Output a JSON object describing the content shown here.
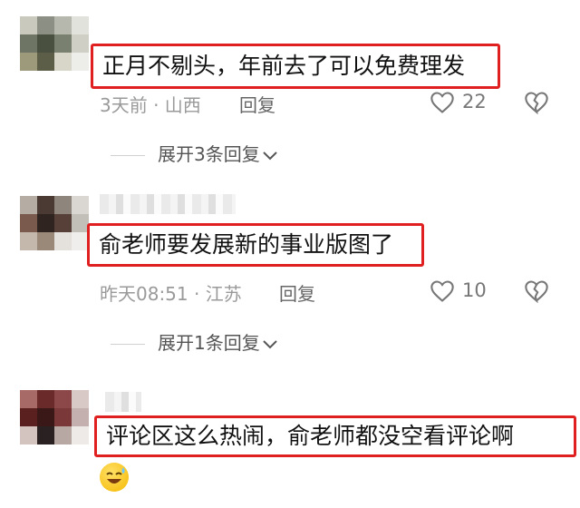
{
  "comments": [
    {
      "text": "正月不剔头，年前去了可以免费理发",
      "time_location": "3天前 · 山西",
      "reply_label": "回复",
      "likes": "22",
      "expand_label": "展开3条回复",
      "icons": [
        "heart-icon",
        "broken-heart-icon",
        "chevron-down-icon"
      ]
    },
    {
      "text": "俞老师要发展新的事业版图了",
      "time_location": "昨天08:51 · 江苏",
      "reply_label": "回复",
      "likes": "10",
      "expand_label": "展开1条回复",
      "icons": [
        "heart-icon",
        "broken-heart-icon",
        "chevron-down-icon"
      ]
    },
    {
      "text": "评论区这么热闹，俞老师都没空看评论啊",
      "emoji": "sweat-smile-emoji"
    }
  ],
  "colors": {
    "highlight_border": "#e02020",
    "meta_text": "#9a9a9a"
  }
}
